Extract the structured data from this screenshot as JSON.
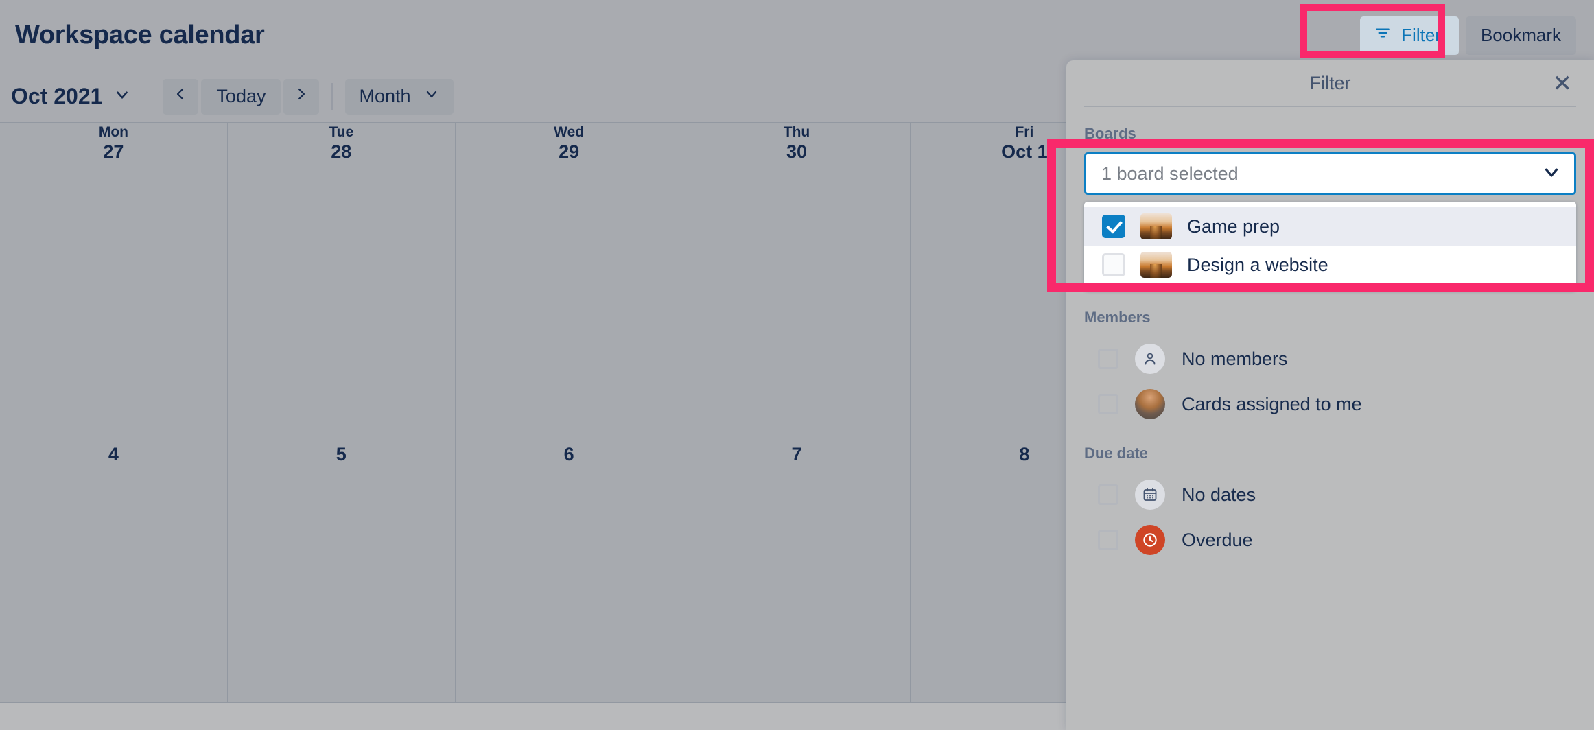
{
  "header": {
    "title": "Workspace calendar",
    "filter_button": {
      "label": "Filter",
      "icon": "filter-icon",
      "text_color": "#0c7fc4",
      "bg_color": "#e4eff5"
    },
    "bookmark_button": {
      "label": "Bookmark"
    }
  },
  "toolbar": {
    "period_label": "Oct 2021",
    "prev_label": "‹",
    "today_label": "Today",
    "next_label": "›",
    "view_label": "Month",
    "chevron": "⌄"
  },
  "calendar": {
    "day_headers": [
      {
        "dow": "Mon",
        "dnum": "27"
      },
      {
        "dow": "Tue",
        "dnum": "28"
      },
      {
        "dow": "Wed",
        "dnum": "29"
      },
      {
        "dow": "Thu",
        "dnum": "30"
      },
      {
        "dow": "Fri",
        "dnum": "Oct 1"
      },
      {
        "dow": "",
        "dnum": ""
      },
      {
        "dow": "",
        "dnum": ""
      }
    ],
    "weeks": [
      {
        "cells": [
          {
            "dnum": ""
          },
          {
            "dnum": ""
          },
          {
            "dnum": ""
          },
          {
            "dnum": ""
          },
          {
            "dnum": ""
          },
          {
            "dnum": ""
          },
          {
            "dnum": ""
          }
        ]
      },
      {
        "cells": [
          {
            "dnum": "4"
          },
          {
            "dnum": "5"
          },
          {
            "dnum": "6"
          },
          {
            "dnum": "7"
          },
          {
            "dnum": "8"
          },
          {
            "dnum": ""
          },
          {
            "dnum": ""
          }
        ]
      }
    ]
  },
  "filter_panel": {
    "title": "Filter",
    "close_icon": "✕",
    "boards": {
      "section_label": "Boards",
      "select_value": "1 board selected",
      "chevron_icon": "chevron-down-icon",
      "options": [
        {
          "label": "Game prep",
          "checked": true
        },
        {
          "label": "Design a website",
          "checked": false
        }
      ]
    },
    "members": {
      "section_label": "Members",
      "options": [
        {
          "label": "No members",
          "checked": false,
          "icon": "person-icon"
        },
        {
          "label": "Cards assigned to me",
          "checked": false,
          "icon": "avatar"
        }
      ]
    },
    "due_date": {
      "section_label": "Due date",
      "options": [
        {
          "label": "No dates",
          "checked": false,
          "icon": "calendar-icon"
        },
        {
          "label": "Overdue",
          "checked": false,
          "icon": "clock-icon"
        }
      ]
    }
  },
  "annotations": {
    "highlight_color": "#f9296b",
    "targets": [
      "filter-button",
      "boards-section"
    ]
  }
}
